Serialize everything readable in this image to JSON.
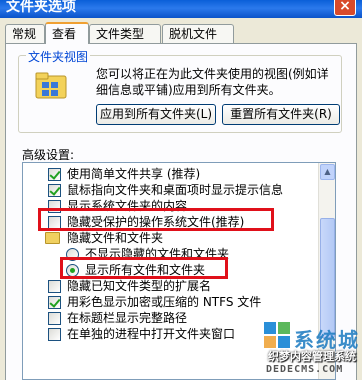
{
  "window": {
    "title": "文件夹选项",
    "close_label": "×"
  },
  "tabs": [
    {
      "label": "常规"
    },
    {
      "label": "查看"
    },
    {
      "label": "文件类型"
    },
    {
      "label": "脱机文件"
    }
  ],
  "folder_views": {
    "legend": "文件夹视图",
    "description": "您可以将正在为此文件夹使用的视图(例如详细信息或平铺)应用到所有文件夹。",
    "apply_all_label": "应用到所有文件夹(L)",
    "reset_all_label": "重置所有文件夹(R)"
  },
  "advanced": {
    "label": "高级设置:",
    "items": [
      {
        "text": "使用简单文件共享 (推荐)",
        "type": "checkbox",
        "checked": true
      },
      {
        "text": "鼠标指向文件夹和桌面项时显示提示信息",
        "type": "checkbox",
        "checked": true
      },
      {
        "text": "显示系统文件夹的内容",
        "type": "checkbox",
        "checked": false
      },
      {
        "text": "隐藏受保护的操作系统文件(推荐)",
        "type": "checkbox",
        "checked": false
      },
      {
        "text": "隐藏文件和文件夹",
        "type": "folder"
      },
      {
        "text": "不显示隐藏的文件和文件夹",
        "type": "radio",
        "checked": false
      },
      {
        "text": "显示所有文件和文件夹",
        "type": "radio",
        "checked": true
      },
      {
        "text": "隐藏已知文件类型的扩展名",
        "type": "checkbox",
        "checked": false
      },
      {
        "text": "用彩色显示加密或压缩的 NTFS 文件",
        "type": "checkbox",
        "checked": true
      },
      {
        "text": "在标题栏显示完整路径",
        "type": "checkbox",
        "checked": false
      },
      {
        "text": "在单独的进程中打开文件夹窗口",
        "type": "checkbox",
        "checked": false
      }
    ]
  },
  "watermark": {
    "brand": "系统城",
    "sub": "织梦内容管理系统",
    "url": "DEDECMS.COM"
  },
  "colors": {
    "highlight": "#e0101a",
    "accent": "#0046d5"
  }
}
